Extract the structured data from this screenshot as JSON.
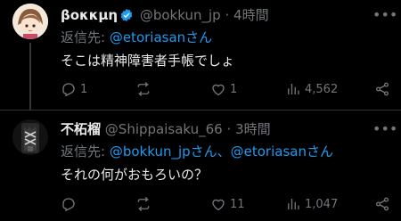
{
  "colors": {
    "background": "#000000",
    "text": "#e7e9ea",
    "muted": "#71767b",
    "link": "#1d9bf0"
  },
  "tweets": [
    {
      "display_name": "βοκκμη",
      "verified": true,
      "handle": "@bokkun_jp",
      "dot": "·",
      "time": "4時間",
      "reply_prefix": "返信先: ",
      "reply_mentions": "@etoriasanさん",
      "text": "そこは精神障害者手帳でしょ",
      "replies": "1",
      "retweets": "",
      "likes": "1",
      "views": "4,562"
    },
    {
      "display_name": "不柘榴",
      "verified": false,
      "handle": "@Shippaisaku_66",
      "dot": "·",
      "time": "3時間",
      "reply_prefix": "返信先: ",
      "reply_mentions": "@bokkun_jpさん、@etoriasanさん",
      "text": "それの何がおもろいの？",
      "replies": "",
      "retweets": "",
      "likes": "11",
      "views": "1,047"
    }
  ]
}
